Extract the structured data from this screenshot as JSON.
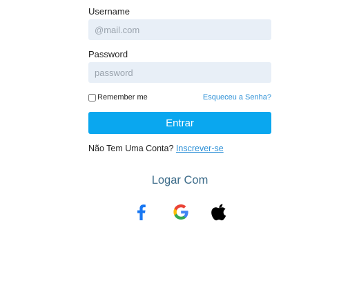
{
  "form": {
    "username_label": "Username",
    "username_placeholder": "@mail.com",
    "password_label": "Password",
    "password_placeholder": "password",
    "remember_label": "Remember me",
    "forgot_label": "Esqueceu a Senha?",
    "submit_label": "Entrar",
    "signup_prompt": "Não Tem Uma Conta?",
    "signup_link": "Inscrever-se"
  },
  "social": {
    "title": "Logar Com",
    "providers": [
      {
        "icon": "facebook-icon",
        "color": "#1877f2"
      },
      {
        "icon": "google-icon",
        "color": "#4285f4"
      },
      {
        "icon": "apple-icon",
        "color": "#000000"
      }
    ]
  },
  "colors": {
    "primary": "#0aa7ef",
    "link": "#2b8fd6",
    "input_bg": "#e8eff7",
    "heading": "#3d6c8a"
  }
}
